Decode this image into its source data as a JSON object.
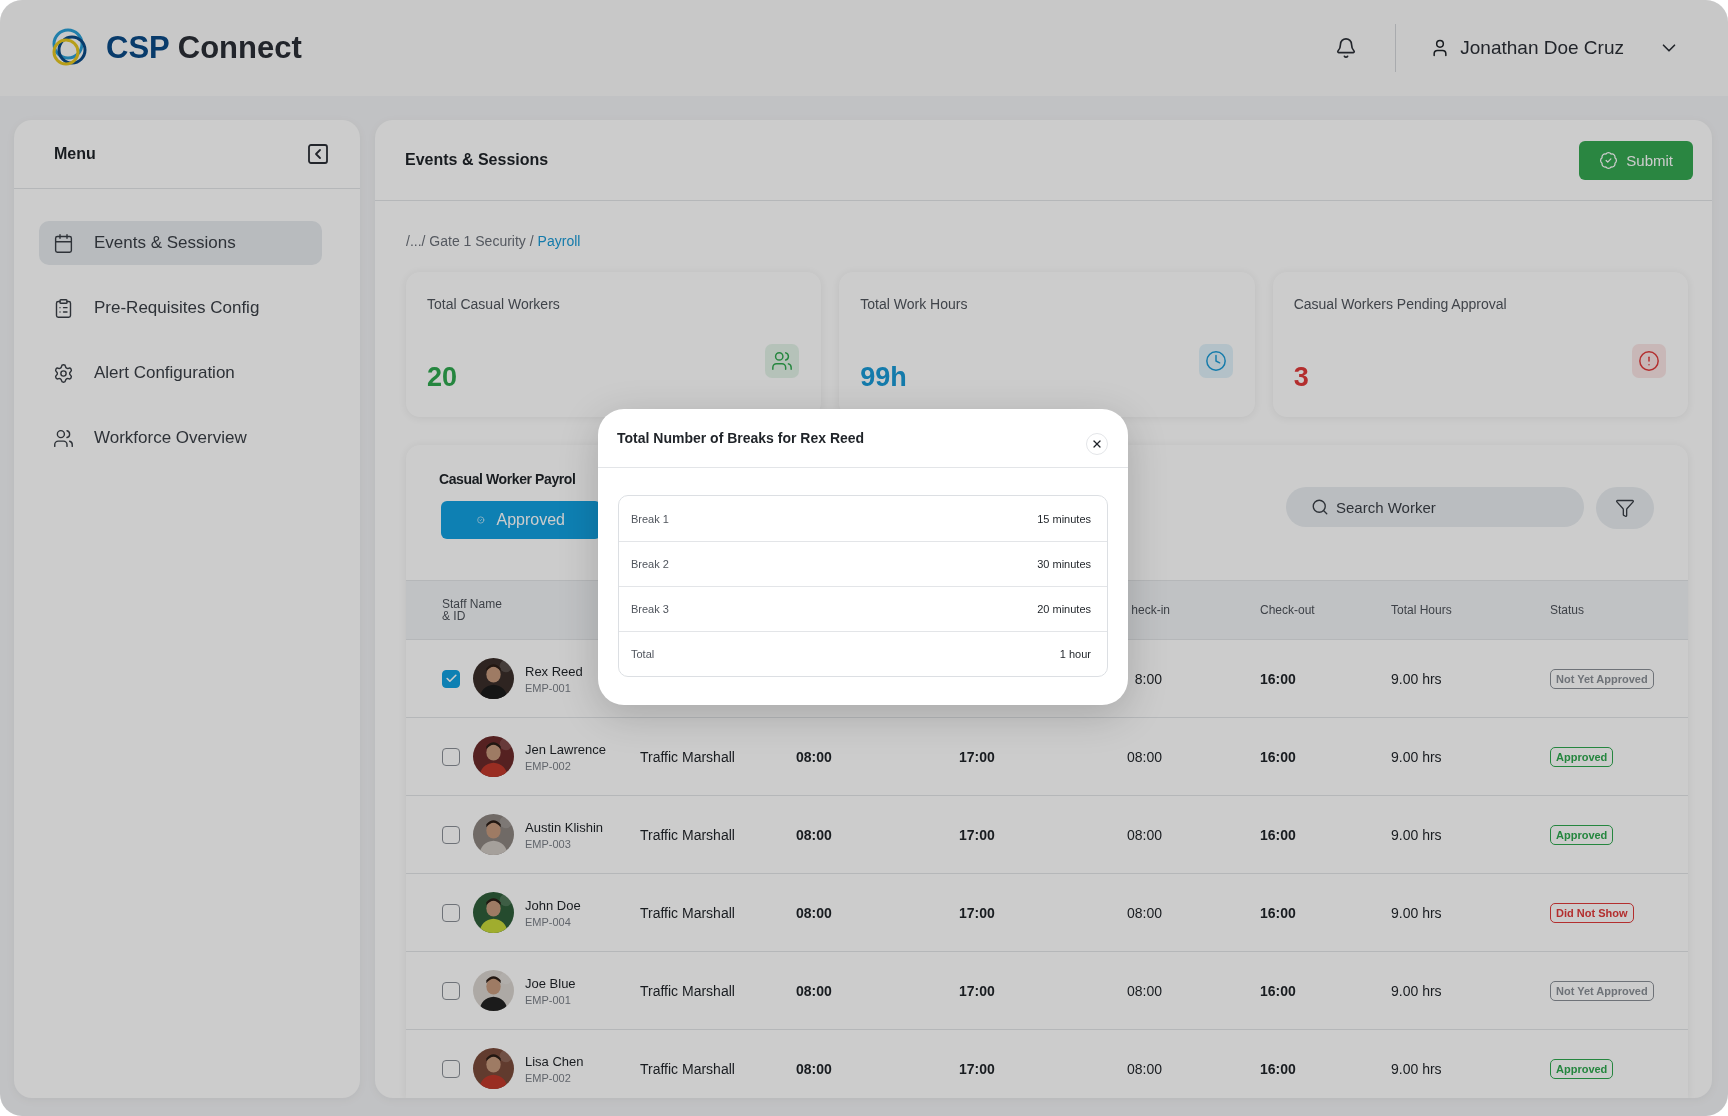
{
  "header": {
    "brand_primary": "CSP",
    "brand_secondary": "Connect",
    "user_name": "Jonathan Doe Cruz"
  },
  "sidebar": {
    "title": "Menu",
    "items": [
      {
        "label": "Events & Sessions",
        "kind": "calendar",
        "selected": true
      },
      {
        "label": "Pre-Requisites Config",
        "kind": "clipboard",
        "selected": false
      },
      {
        "label": "Alert Configuration",
        "kind": "settings",
        "selected": false
      },
      {
        "label": "Workforce Overview",
        "kind": "users",
        "selected": false
      }
    ]
  },
  "main": {
    "title": "Events & Sessions",
    "submit_label": "Submit",
    "breadcrumb": {
      "path": "/.../ Gate 1 Security /",
      "current": "Payroll"
    },
    "stats": [
      {
        "label": "Total Casual Workers",
        "value": "20",
        "kind": "workers"
      },
      {
        "label": "Total Work Hours",
        "value": "99h",
        "kind": "hours"
      },
      {
        "label": "Casual Workers Pending Approval",
        "value": "3",
        "kind": "pending"
      }
    ],
    "table": {
      "title": "Casual Worker Payrol",
      "filter_label": "Approved",
      "search_placeholder": "Search Worker",
      "columns": [
        "Staff Name & ID",
        "heck-in",
        "Check-out",
        "Total Hours",
        "Status"
      ],
      "rows": [
        {
          "name": "Rex Reed",
          "id": "EMP-001",
          "checked": true,
          "check_in": "8:00",
          "check_out": "16:00",
          "total_hours": "9.00 hrs",
          "status": "Not Yet Approved",
          "kind": "pending"
        },
        {
          "name": "Jen Lawrence",
          "id": "EMP-002",
          "checked": false,
          "role": "Traffic Marshall",
          "start": "08:00",
          "end": "17:00",
          "check_in": "08:00",
          "check_out": "16:00",
          "total_hours": "9.00 hrs",
          "status": "Approved",
          "kind": "approved"
        },
        {
          "name": "Austin Klishin",
          "id": "EMP-003",
          "checked": false,
          "role": "Traffic Marshall",
          "start": "08:00",
          "end": "17:00",
          "check_in": "08:00",
          "check_out": "16:00",
          "total_hours": "9.00 hrs",
          "status": "Approved",
          "kind": "approved"
        },
        {
          "name": "John Doe",
          "id": "EMP-004",
          "checked": false,
          "role": "Traffic Marshall",
          "start": "08:00",
          "end": "17:00",
          "check_in": "08:00",
          "check_out": "16:00",
          "total_hours": "9.00 hrs",
          "status": "Did Not Show",
          "kind": "no_show"
        },
        {
          "name": "Joe Blue",
          "id": "EMP-001",
          "checked": false,
          "role": "Traffic Marshall",
          "start": "08:00",
          "end": "17:00",
          "check_in": "08:00",
          "check_out": "16:00",
          "total_hours": "9.00 hrs",
          "status": "Not Yet Approved",
          "kind": "pending"
        },
        {
          "name": "Lisa Chen",
          "id": "EMP-002",
          "checked": false,
          "role": "Traffic Marshall",
          "start": "08:00",
          "end": "17:00",
          "check_in": "08:00",
          "check_out": "16:00",
          "total_hours": "9.00 hrs",
          "status": "Approved",
          "kind": "approved"
        }
      ]
    }
  },
  "modal": {
    "title": "Total Number of Breaks for Rex Reed",
    "rows": [
      {
        "label": "Break 1",
        "value": "15 minutes"
      },
      {
        "label": "Break 2",
        "value": "30 minutes"
      },
      {
        "label": "Break 3",
        "value": "20 minutes"
      },
      {
        "label": "Total",
        "value": "1 hour"
      }
    ]
  }
}
